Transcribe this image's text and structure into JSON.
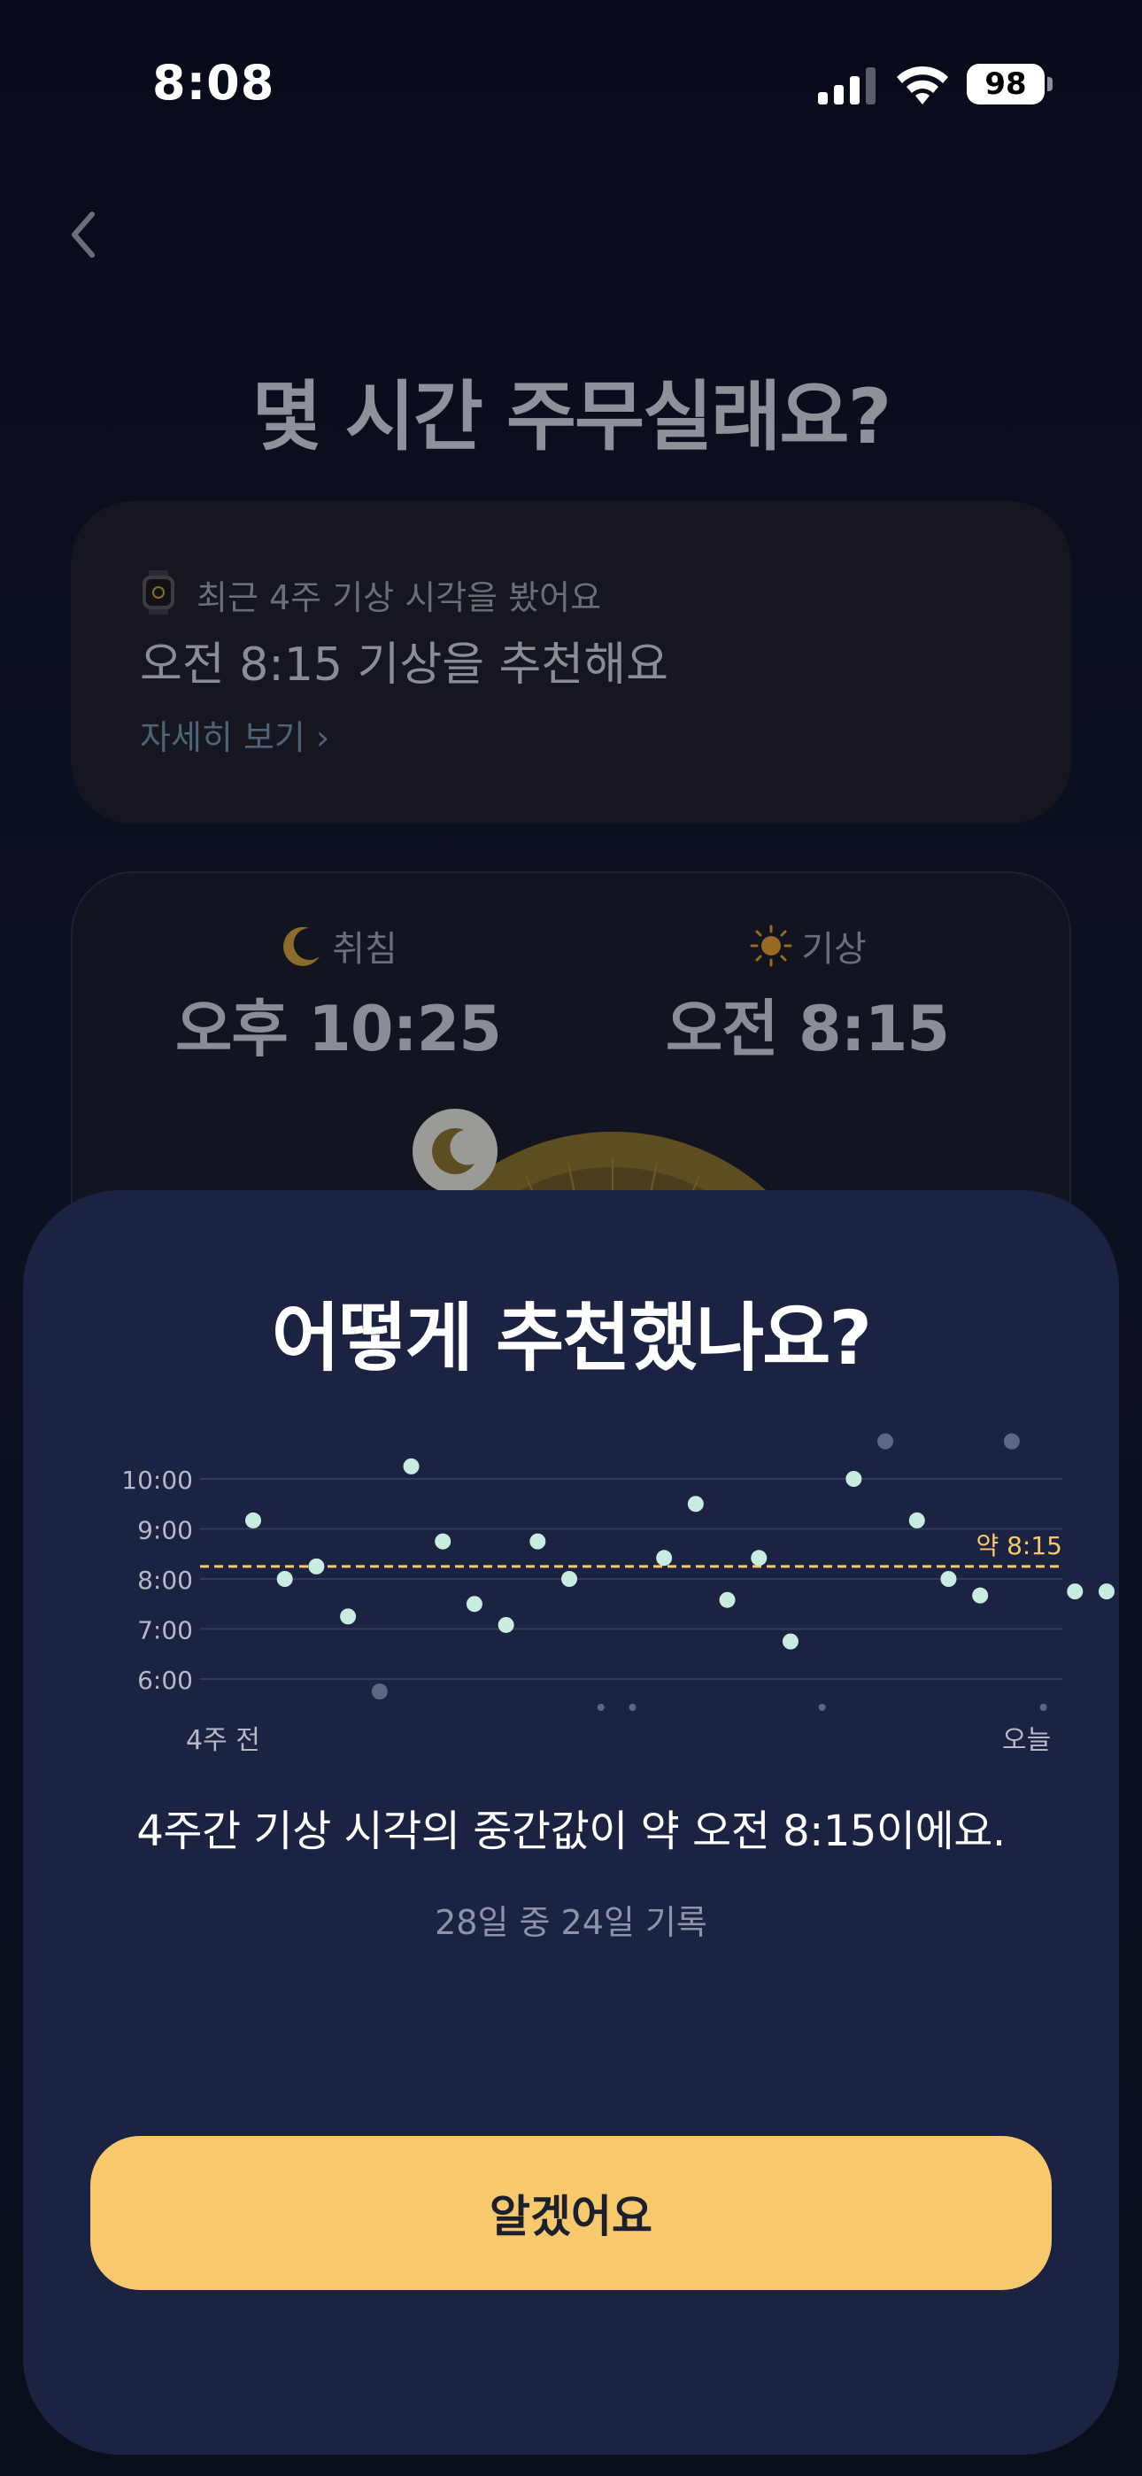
{
  "status_bar": {
    "time": "8:08",
    "battery": "98"
  },
  "header": {
    "title": "몇 시간 주무실래요?"
  },
  "recommendation_card": {
    "caption": "최근 4주 기상 시각을 봤어요",
    "main": "오전 8:15 기상을 추천해요",
    "detail_link": "자세히 보기 ›"
  },
  "time_card": {
    "bedtime_label": "취침",
    "bedtime_value": "오후 10:25",
    "wake_label": "기상",
    "wake_value": "오전 8:15"
  },
  "sheet": {
    "title": "어떻게 추천했나요?",
    "x_start_label": "4주 전",
    "x_end_label": "오늘",
    "summary": "4주간 기상 시각의 중간값이 약 오전 8:15이에요.",
    "record_count": "28일 중 24일 기록",
    "confirm_button": "알겠어요"
  },
  "colors": {
    "accent": "#f7c86c",
    "sheet_bg": "#1b2242",
    "point": "#c8ecdf",
    "point_outlier": "#5d6683"
  },
  "chart_data": {
    "type": "scatter",
    "title": "",
    "xlabel": "",
    "ylabel": "",
    "y_tick_labels": [
      "10:00",
      "9:00",
      "8:00",
      "7:00",
      "6:00"
    ],
    "y_ticks": [
      10,
      9,
      8,
      7,
      6
    ],
    "ylim": [
      6,
      10
    ],
    "x_start_label": "4주 전",
    "x_end_label": "오늘",
    "median_label": "약 8:15",
    "median_value": 8.25,
    "grid": true,
    "points": [
      {
        "day": 1,
        "value": 9.17
      },
      {
        "day": 2,
        "value": 8.0
      },
      {
        "day": 3,
        "value": 8.25
      },
      {
        "day": 4,
        "value": 7.25
      },
      {
        "day": 5,
        "value": 5.75,
        "outlier": true
      },
      {
        "day": 6,
        "value": 10.25
      },
      {
        "day": 7,
        "value": 8.75
      },
      {
        "day": 8,
        "value": 7.5
      },
      {
        "day": 9,
        "value": 7.08
      },
      {
        "day": 10,
        "value": 8.75
      },
      {
        "day": 11,
        "value": 8.0
      },
      {
        "day": 12,
        "missing": true
      },
      {
        "day": 13,
        "missing": true
      },
      {
        "day": 14,
        "value": 8.42
      },
      {
        "day": 15,
        "value": 9.5
      },
      {
        "day": 16,
        "value": 7.58
      },
      {
        "day": 17,
        "value": 8.42
      },
      {
        "day": 18,
        "value": 6.75
      },
      {
        "day": 19,
        "missing": true
      },
      {
        "day": 20,
        "value": 10.0
      },
      {
        "day": 21,
        "value": 10.75,
        "outlier": true
      },
      {
        "day": 22,
        "value": 9.17
      },
      {
        "day": 23,
        "value": 8.0
      },
      {
        "day": 24,
        "value": 7.67
      },
      {
        "day": 25,
        "value": 10.75,
        "outlier": true
      },
      {
        "day": 26,
        "missing": true
      },
      {
        "day": 27,
        "value": 7.75
      },
      {
        "day": 28,
        "value": 7.75
      }
    ]
  }
}
